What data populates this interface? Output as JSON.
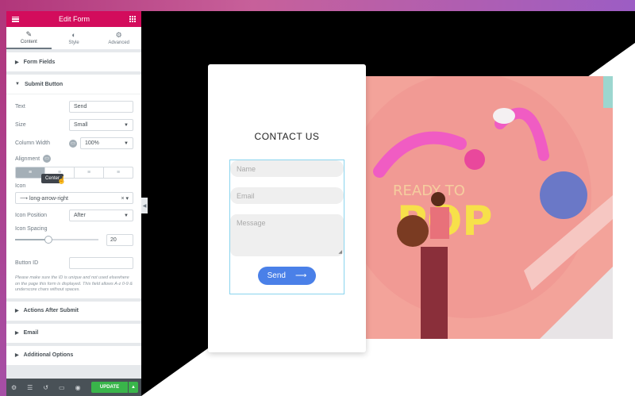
{
  "panel": {
    "title": "Edit Form",
    "tabs": [
      {
        "label": "Content",
        "icon": "pencil-icon"
      },
      {
        "label": "Style",
        "icon": "half-circle-icon"
      },
      {
        "label": "Advanced",
        "icon": "gear-icon"
      }
    ],
    "sections": {
      "form_fields": "Form Fields",
      "submit_button": "Submit Button",
      "actions_after_submit": "Actions After Submit",
      "email": "Email",
      "additional_options": "Additional Options"
    },
    "controls": {
      "text_label": "Text",
      "text_value": "Send",
      "size_label": "Size",
      "size_value": "Small",
      "column_width_label": "Column Width",
      "column_width_value": "100%",
      "alignment_label": "Alignment",
      "alignment_tooltip": "Center",
      "icon_label": "Icon",
      "icon_value": "long-arrow-right",
      "icon_position_label": "Icon Position",
      "icon_position_value": "After",
      "icon_spacing_label": "Icon Spacing",
      "icon_spacing_value": "20",
      "icon_spacing_level": 0.4,
      "button_id_label": "Button ID",
      "button_id_value": "",
      "help_text": "Please make sure the ID is unique and not used elsewhere on the page this form is displayed. This field allows A-z 0-9 & underscore chars without spaces."
    },
    "footer": {
      "update_label": "UPDATE"
    }
  },
  "preview": {
    "form_title": "CONTACT US",
    "name_placeholder": "Name",
    "email_placeholder": "Email",
    "message_placeholder": "Message",
    "send_label": "Send"
  },
  "colors": {
    "accent": "#d30c5c",
    "update": "#39b54a",
    "send_button": "#4a80e8"
  }
}
